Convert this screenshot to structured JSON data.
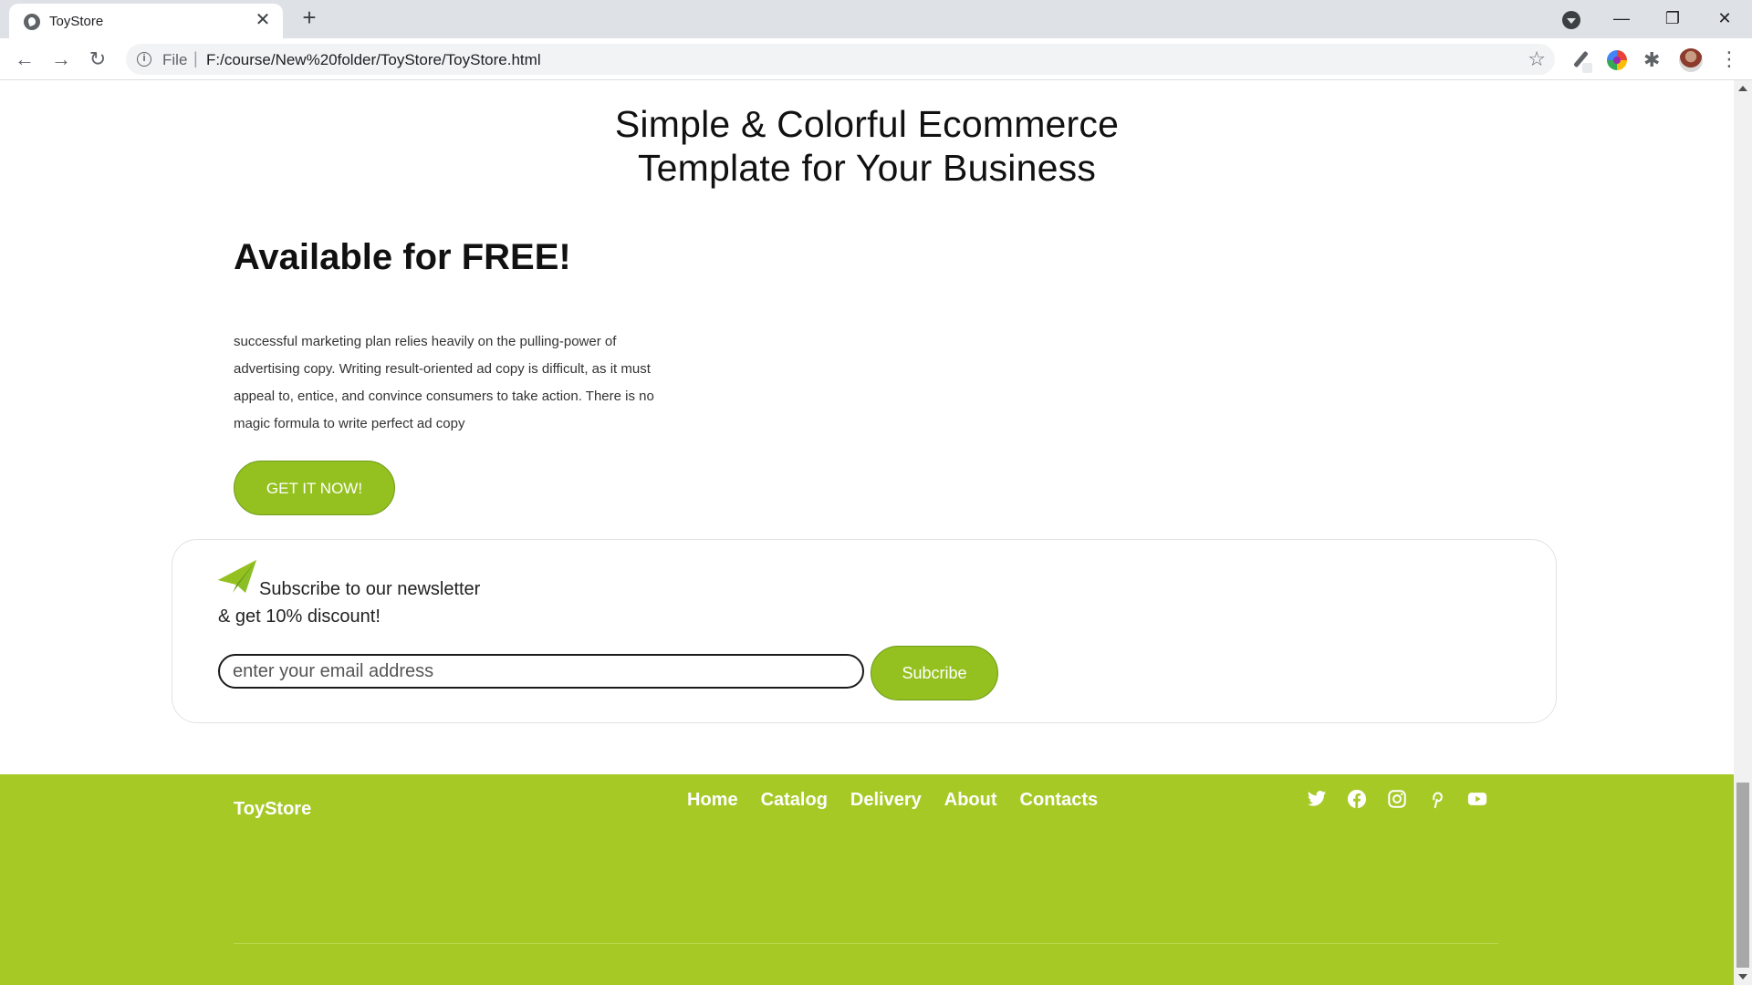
{
  "browser": {
    "tab_title": "ToyStore",
    "tab_close": "✕",
    "new_tab": "+",
    "url_scheme": "File",
    "url_separator": "|",
    "url": "F:/course/New%20folder/ToyStore/ToyStore.html",
    "window_minimize": "—",
    "window_restore": "❐",
    "window_close": "✕"
  },
  "hero": {
    "title_line1": "Simple & Colorful Ecommerce",
    "title_line2": "Template for Your Business"
  },
  "promo": {
    "heading": "Available for FREE!",
    "description": "successful marketing plan relies heavily on the pulling-power of advertising copy. Writing result-oriented ad copy is difficult, as it must appeal to, entice, and convince consumers to take action. There is no magic formula to write perfect ad copy",
    "cta_label": "GET IT NOW!"
  },
  "newsletter": {
    "line1": "Subscribe to our newsletter",
    "line2": "& get 10% discount!",
    "email_placeholder": "enter your email address",
    "button_label": "Subcribe"
  },
  "footer": {
    "brand": "ToyStore",
    "nav": [
      "Home",
      "Catalog",
      "Delivery",
      "About",
      "Contacts"
    ],
    "socials": [
      "twitter-icon",
      "facebook-icon",
      "instagram-icon",
      "pinterest-icon",
      "youtube-icon"
    ]
  },
  "colors": {
    "accent": "#94c11f",
    "footer_bg": "#a6c926",
    "text": "#111111"
  }
}
